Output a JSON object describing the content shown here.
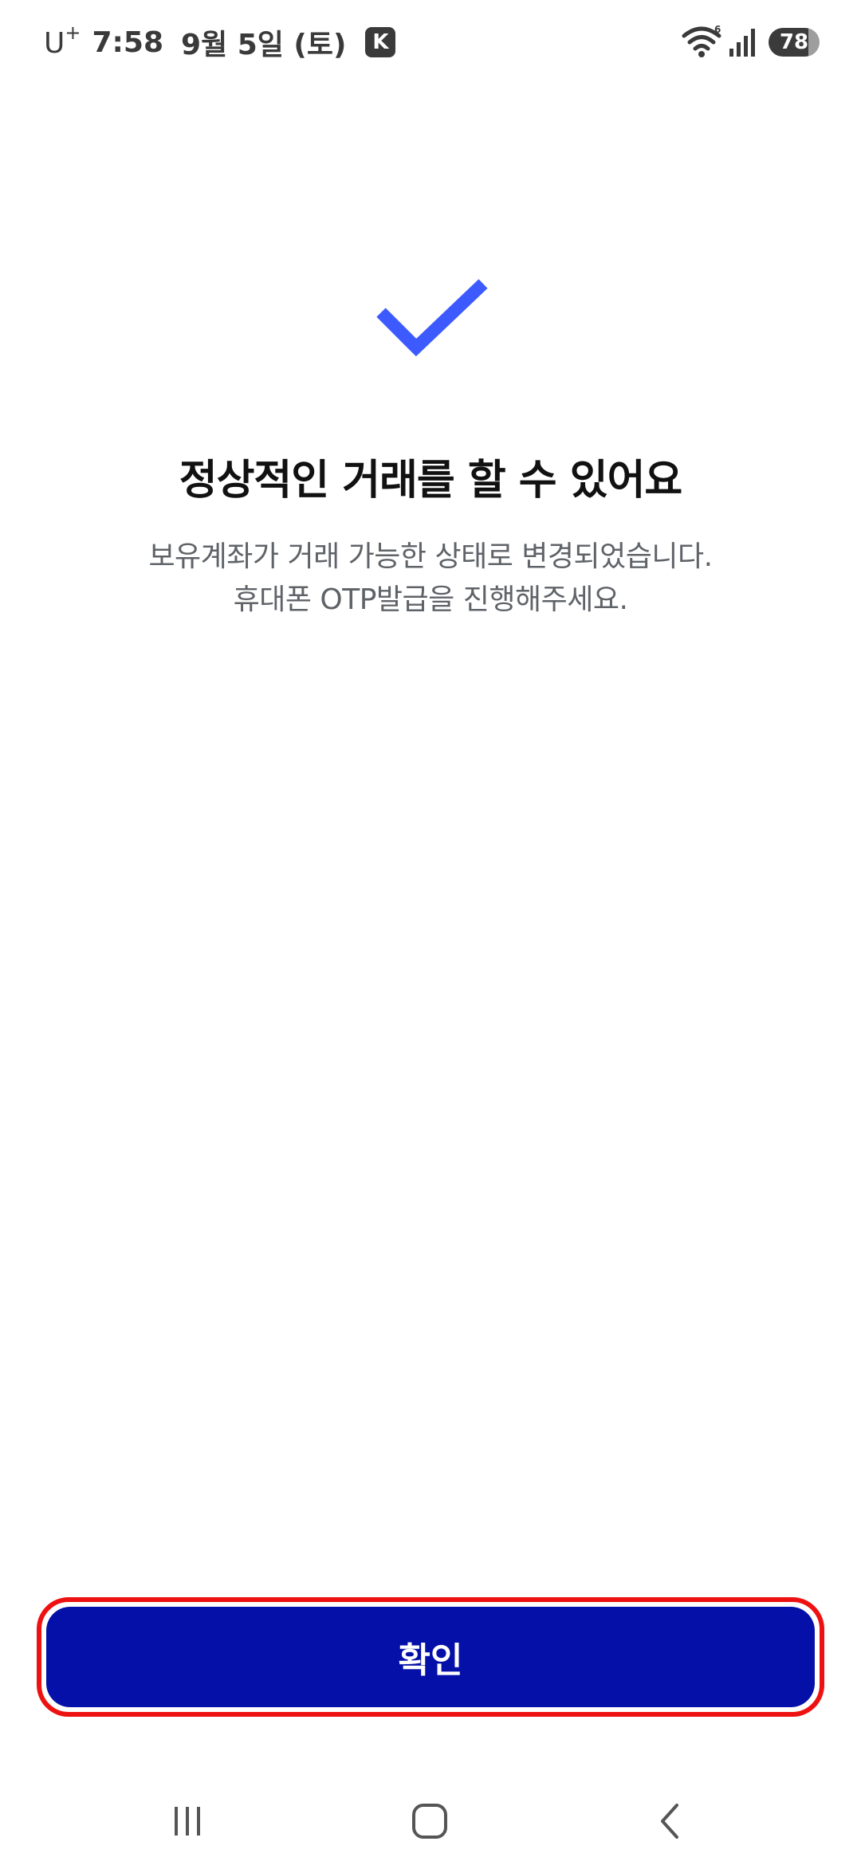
{
  "status_bar": {
    "carrier": "U",
    "carrier_sup": "+",
    "time": "7:58",
    "date": "9월 5일 (토)",
    "badge": "K",
    "battery": "78",
    "icons": [
      "wifi-icon",
      "signal-icon",
      "battery-icon"
    ]
  },
  "main": {
    "icon": "checkmark-icon",
    "title": "정상적인 거래를 할 수 있어요",
    "description_line1": "보유계좌가 거래 가능한 상태로 변경되었습니다.",
    "description_line2": "휴대폰 OTP발급을 진행해주세요.",
    "confirm_label": "확인"
  },
  "nav_bar": {
    "icons": [
      "recent-apps-icon",
      "home-icon",
      "back-icon"
    ]
  },
  "colors": {
    "accent_check": "#3d5afe",
    "button_bg": "#0510a8",
    "highlight_border": "#ee1111",
    "description_text": "#5f6368"
  }
}
